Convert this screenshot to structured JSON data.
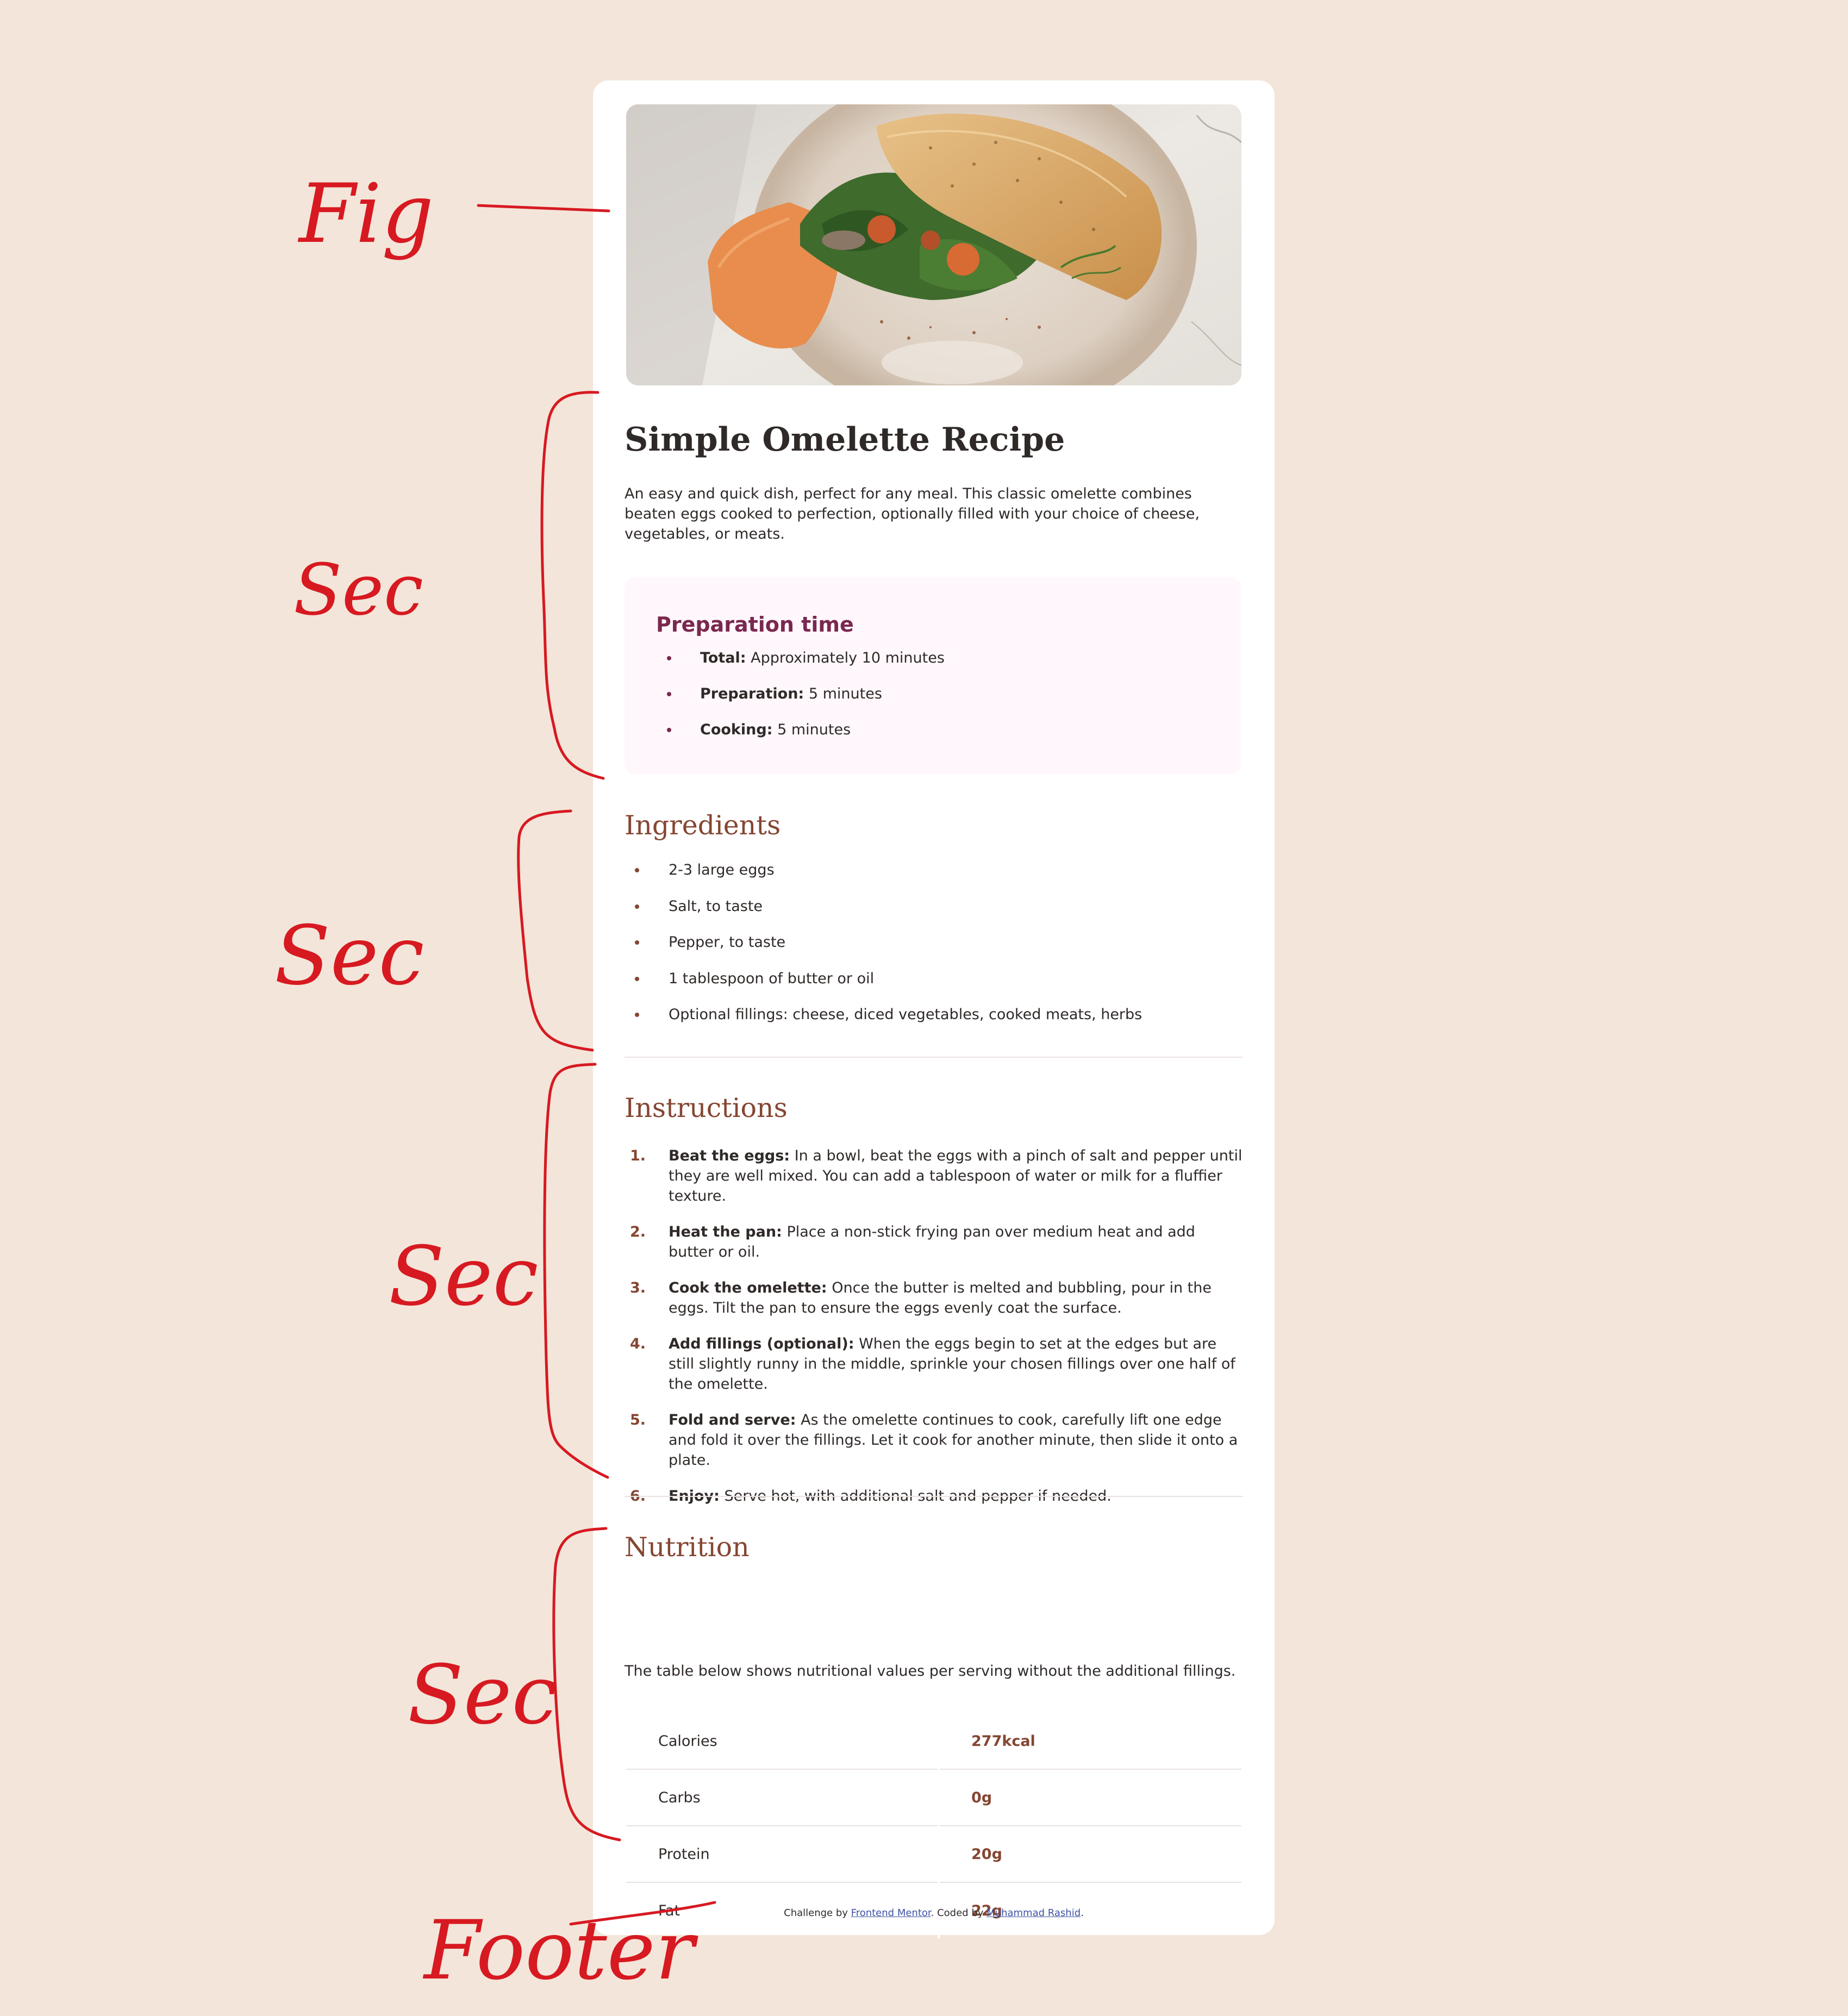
{
  "recipe": {
    "title": "Simple Omelette Recipe",
    "description": "An easy and quick dish, perfect for any meal. This classic omelette combines beaten eggs cooked to perfection, optionally filled with your choice of cheese, vegetables, or meats.",
    "preparation": {
      "title": "Preparation time",
      "items": [
        {
          "label": "Total:",
          "value": "Approximately 10 minutes"
        },
        {
          "label": "Preparation:",
          "value": "5 minutes"
        },
        {
          "label": "Cooking:",
          "value": "5 minutes"
        }
      ]
    },
    "ingredients": {
      "title": "Ingredients",
      "items": [
        "2-3 large eggs",
        "Salt, to taste",
        "Pepper, to taste",
        "1 tablespoon of butter or oil",
        "Optional fillings: cheese, diced vegetables, cooked meats, herbs"
      ]
    },
    "instructions": {
      "title": "Instructions",
      "steps": [
        {
          "num": "1.",
          "label": "Beat the eggs:",
          "text": "In a bowl, beat the eggs with a pinch of salt and pepper until they are well mixed. You can add a tablespoon of water or milk for a fluffier texture."
        },
        {
          "num": "2.",
          "label": "Heat the pan:",
          "text": "Place a non-stick frying pan over medium heat and add butter or oil."
        },
        {
          "num": "3.",
          "label": "Cook the omelette:",
          "text": "Once the butter is melted and bubbling, pour in the eggs. Tilt the pan to ensure the eggs evenly coat the surface."
        },
        {
          "num": "4.",
          "label": "Add fillings (optional):",
          "text": "When the eggs begin to set at the edges but are still slightly runny in the middle, sprinkle your chosen fillings over one half of the omelette."
        },
        {
          "num": "5.",
          "label": "Fold and serve:",
          "text": "As the omelette continues to cook, carefully lift one edge and fold it over the fillings. Let it cook for another minute, then slide it onto a plate."
        },
        {
          "num": "6.",
          "label": "Enjoy:",
          "text": "Serve hot, with additional salt and pepper if needed."
        }
      ]
    },
    "nutrition": {
      "title": "Nutrition",
      "intro": "The table below shows nutritional values per serving without the additional fillings.",
      "rows": [
        {
          "name": "Calories",
          "value": "277kcal"
        },
        {
          "name": "Carbs",
          "value": "0g"
        },
        {
          "name": "Protein",
          "value": "20g"
        },
        {
          "name": "Fat",
          "value": "22g"
        }
      ]
    }
  },
  "footer": {
    "prefix": "Challenge by ",
    "link1": "Frontend Mentor",
    "middle": ". Coded by ",
    "link2": "Muhammad Rashid",
    "suffix": "."
  },
  "annotations": {
    "fig": "Fig",
    "sec1": "Sec",
    "sec2": "Sec",
    "sec3": "Sec",
    "sec4": "Sec",
    "footer": "Footer"
  },
  "colors": {
    "background": "#f3e5d9",
    "card": "#ffffff",
    "accent_brown": "#854632",
    "accent_rose": "#7a2850",
    "prep_bg": "#fff7fb",
    "annotation_red": "#d71921",
    "link": "#3e52a3"
  }
}
